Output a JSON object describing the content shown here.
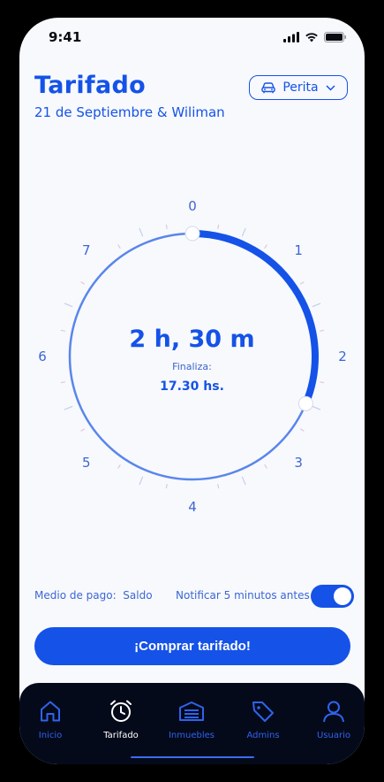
{
  "status_bar": {
    "time": "9:41"
  },
  "header": {
    "title": "Tarifado",
    "subtitle": "21 de Septiembre & Wiliman",
    "vehicle": "Perita"
  },
  "dial": {
    "hour_labels": [
      "0",
      "1",
      "2",
      "3",
      "4",
      "5",
      "6",
      "7"
    ],
    "selected_hours": 2.5,
    "duration": "2 h, 30 m",
    "ends_label": "Finaliza:",
    "ends_time": "17.30 hs."
  },
  "options": {
    "payment_label": "Medio de pago:",
    "payment_value": "Saldo",
    "notify_label": "Notificar 5 minutos antes",
    "notify_on": true
  },
  "buy_button": "¡Comprar tarifado!",
  "tabs": [
    {
      "label": "Inicio",
      "icon": "home-icon"
    },
    {
      "label": "Tarifado",
      "icon": "alarm-clock-icon",
      "active": true
    },
    {
      "label": "Inmuebles",
      "icon": "garage-icon"
    },
    {
      "label": "Admins",
      "icon": "tag-icon"
    },
    {
      "label": "Usuario",
      "icon": "user-icon"
    }
  ],
  "colors": {
    "accent": "#1552e8",
    "tabbar": "#050a1a",
    "background": "#f7f9fd"
  }
}
